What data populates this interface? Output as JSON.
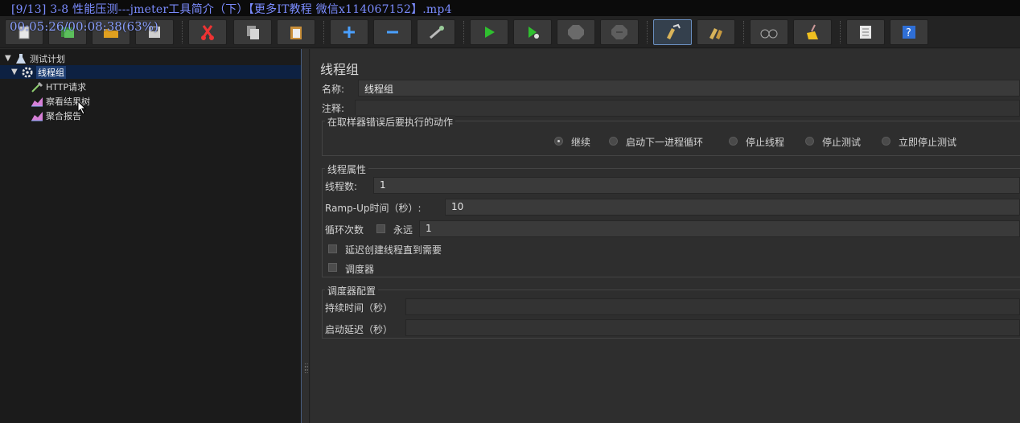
{
  "overlay": {
    "video_title": "[9/13] 3-8 性能压测---jmeter工具简介（下）【更多IT教程 微信x114067152】.mp4",
    "timer": "00:05:26/00:08:38(63%)"
  },
  "toolbar": {
    "buttons": [
      {
        "name": "new",
        "icon": "new-icon"
      },
      {
        "name": "templates",
        "icon": "templates-icon"
      },
      {
        "name": "open",
        "icon": "open-folder-icon"
      },
      {
        "name": "save",
        "icon": "save-icon"
      },
      {
        "name": "cut",
        "icon": "cut-icon"
      },
      {
        "name": "copy",
        "icon": "copy-icon"
      },
      {
        "name": "paste",
        "icon": "paste-icon"
      },
      {
        "name": "expand",
        "icon": "plus-icon"
      },
      {
        "name": "collapse",
        "icon": "minus-icon"
      },
      {
        "name": "toggle",
        "icon": "toggle-icon"
      },
      {
        "name": "start",
        "icon": "play-icon"
      },
      {
        "name": "start-no-pauses",
        "icon": "play-no-pause-icon"
      },
      {
        "name": "stop",
        "icon": "stop-icon"
      },
      {
        "name": "shutdown",
        "icon": "shutdown-icon"
      },
      {
        "name": "clear",
        "icon": "clear-icon"
      },
      {
        "name": "clear-all",
        "icon": "clear-all-icon"
      },
      {
        "name": "search",
        "icon": "binoculars-icon"
      },
      {
        "name": "reset-search",
        "icon": "broom-icon"
      },
      {
        "name": "function-helper",
        "icon": "list-icon"
      },
      {
        "name": "help",
        "icon": "help-icon"
      }
    ]
  },
  "tree": {
    "items": [
      {
        "label": "测试计划",
        "icon": "flask-icon",
        "level": 0,
        "expanded": true
      },
      {
        "label": "线程组",
        "icon": "gear-icon",
        "level": 1,
        "expanded": true,
        "selected": true
      },
      {
        "label": "HTTP请求",
        "icon": "pipette-icon",
        "level": 2
      },
      {
        "label": "察看结果树",
        "icon": "chart-icon",
        "level": 2
      },
      {
        "label": "聚合报告",
        "icon": "chart-icon",
        "level": 2
      }
    ]
  },
  "panel": {
    "title": "线程组",
    "name_label": "名称:",
    "name_value": "线程组",
    "comment_label": "注释:",
    "comment_value": "",
    "error_group": {
      "title": "在取样器错误后要执行的动作",
      "options": [
        "继续",
        "启动下一进程循环",
        "停止线程",
        "停止测试",
        "立即停止测试"
      ],
      "selected": "继续"
    },
    "thread_props": {
      "title": "线程属性",
      "threads_label": "线程数:",
      "threads_value": "1",
      "rampup_label": "Ramp-Up时间（秒）:",
      "rampup_value": "10",
      "loop_label": "循环次数",
      "forever_label": "永远",
      "loop_value": "1",
      "delay_label": "延迟创建线程直到需要",
      "scheduler_label": "调度器"
    },
    "scheduler_config": {
      "title": "调度器配置",
      "duration_label": "持续时间（秒）",
      "duration_value": "",
      "startup_delay_label": "启动延迟（秒）",
      "startup_delay_value": ""
    }
  }
}
